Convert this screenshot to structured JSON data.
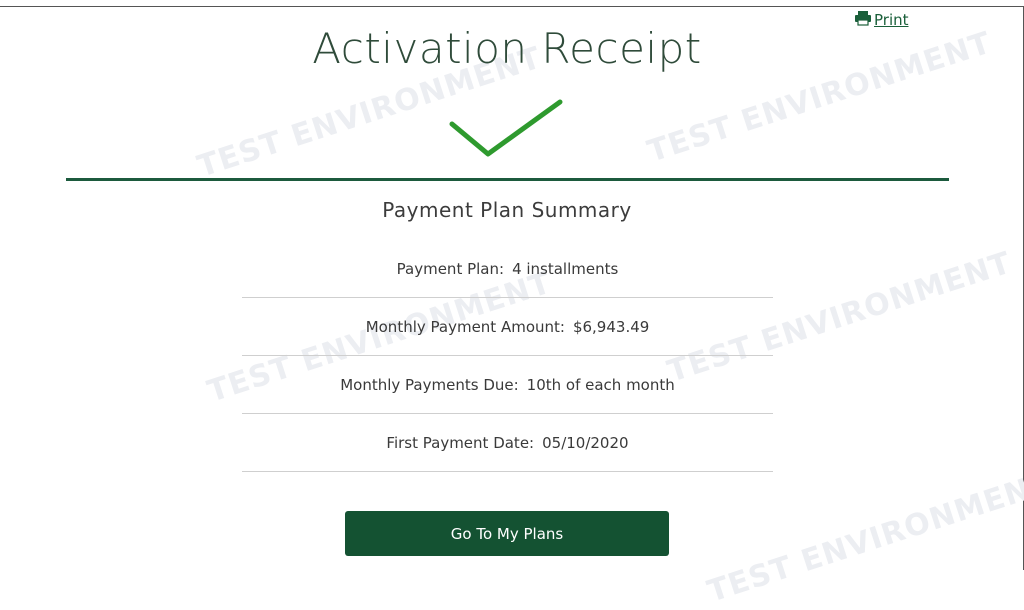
{
  "header": {
    "print_label": "Print",
    "title": "Activation Receipt"
  },
  "watermark": {
    "text": "TEST ENVIRONMENT"
  },
  "summary": {
    "title": "Payment Plan Summary",
    "rows": [
      {
        "label": "Payment Plan:",
        "value": "4 installments"
      },
      {
        "label": "Monthly Payment Amount:",
        "value": "$6,943.49"
      },
      {
        "label": "Monthly Payments Due:",
        "value": "10th of each month"
      },
      {
        "label": "First Payment Date:",
        "value": "05/10/2020"
      }
    ]
  },
  "actions": {
    "primary_label": "Go To My Plans"
  },
  "colors": {
    "brand_green": "#145232",
    "check_green": "#2e9a2e",
    "divider_green": "#1c5a3d"
  },
  "icons": {
    "print": "printer-icon",
    "success": "checkmark-icon"
  }
}
